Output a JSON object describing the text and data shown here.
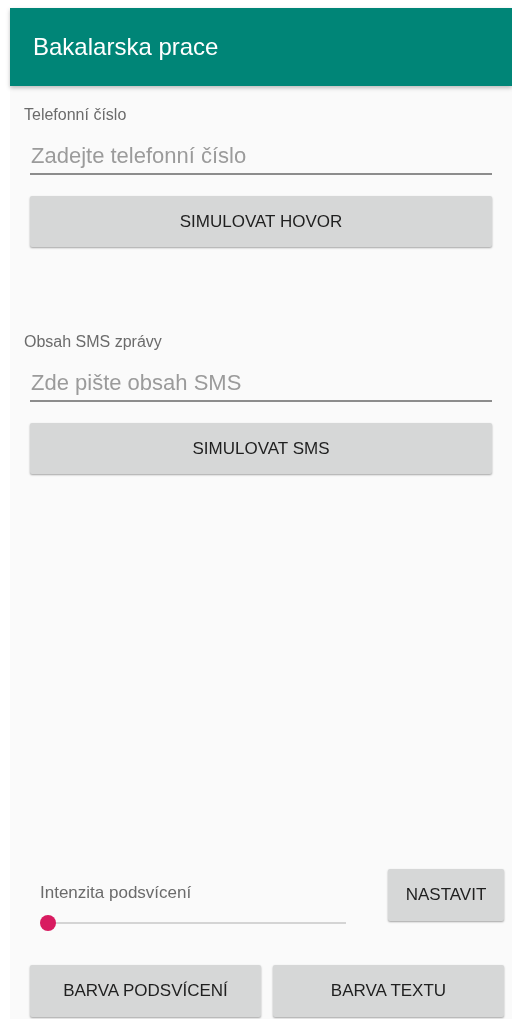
{
  "app_bar": {
    "title": "Bakalarska prace"
  },
  "phone": {
    "label": "Telefonní číslo",
    "placeholder": "Zadejte telefonní číslo",
    "button": "SIMULOVAT HOVOR"
  },
  "sms": {
    "label": "Obsah SMS zprávy",
    "placeholder": "Zde pište obsah SMS",
    "button": "SIMULOVAT SMS"
  },
  "backlight": {
    "label": "Intenzita podsvícení",
    "level": 0,
    "button": "NASTAVIT"
  },
  "color_buttons": [
    "BARVA PODSVÍCENÍ",
    "BARVA TEXTU"
  ]
}
